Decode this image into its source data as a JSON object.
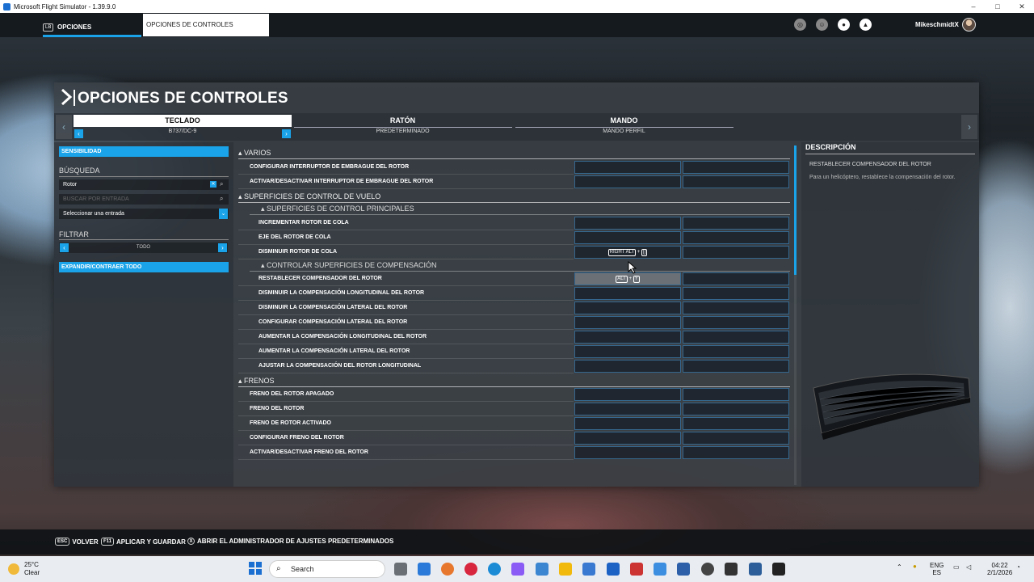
{
  "window": {
    "title": "Microsoft Flight Simulator - 1.39.9.0"
  },
  "topbar": {
    "lb": "LB",
    "tab_options": "OPCIONES",
    "tab_controls": "OPCIONES DE CONTROLES",
    "username": "MikeschmidtX"
  },
  "panel": {
    "title": "OPCIONES DE CONTROLES"
  },
  "devices": [
    {
      "name": "TECLADO",
      "profile": "B737/DC-9"
    },
    {
      "name": "RATÓN",
      "profile": "PREDETERMINADO"
    },
    {
      "name": "MANDO",
      "profile": "MANDO PERFIL"
    }
  ],
  "left": {
    "sensitivity": "SENSIBILIDAD",
    "search_header": "BÚSQUEDA",
    "search_value": "Rotor",
    "search_input_placeholder": "BUSCAR POR ENTRADA",
    "select_entry": "Seleccionar una entrada",
    "filter_header": "FILTRAR",
    "filter_value": "TODO",
    "expand": "EXPANDIR/CONTRAER TODO"
  },
  "groups": {
    "varios": "VARIOS",
    "flight": "SUPERFICIES DE CONTROL DE VUELO",
    "principal": "SUPERFICIES DE CONTROL PRINCIPALES",
    "trim": "CONTROLAR SUPERFICIES DE COMPENSACIÓN",
    "brakes": "FRENOS"
  },
  "rows": {
    "varios": [
      "CONFIGURAR INTERRUPTOR DE EMBRAGUE DEL ROTOR",
      "ACTIVAR/DESACTIVAR INTERRUPTOR DE EMBRAGUE DEL ROTOR"
    ],
    "principal": [
      "INCREMENTAR ROTOR DE COLA",
      "EJE DEL ROTOR DE COLA",
      "DISMINUIR ROTOR DE COLA"
    ],
    "trim": [
      "RESTABLECER COMPENSADOR DEL ROTOR",
      "DISMINUIR LA COMPENSACIÓN LONGITUDINAL DEL ROTOR",
      "DISMINUIR LA COMPENSACIÓN LATERAL DEL ROTOR",
      "CONFIGURAR COMPENSACIÓN LATERAL DEL ROTOR",
      "AUMENTAR LA COMPENSACIÓN LONGITUDINAL DEL ROTOR",
      "AUMENTAR LA COMPENSACIÓN LATERAL DEL ROTOR",
      "AJUSTAR LA COMPENSACIÓN DEL ROTOR LONGITUDINAL"
    ],
    "brakes": [
      "FRENO DEL ROTOR APAGADO",
      "FRENO DEL ROTOR",
      "FRENO DE ROTOR ACTIVADO",
      "CONFIGURAR FRENO DEL ROTOR",
      "ACTIVAR/DESACTIVAR FRENO DEL ROTOR"
    ]
  },
  "bindings": {
    "decrease_tail_key": "RIGHT ALT",
    "decrease_tail_plus": "+",
    "decrease_tail_extra": "[]",
    "reset_trim_key1": "ALT",
    "reset_trim_plus": "+",
    "reset_trim_key2": "Y"
  },
  "description": {
    "header": "DESCRIPCIÓN",
    "title": "RESTABLECER COMPENSADOR DEL ROTOR",
    "body": "Para un helicóptero, restablece la compensación del rotor."
  },
  "bottom": {
    "back_key": "ESC",
    "back": "VOLVER",
    "apply_key": "F11",
    "apply": "APLICAR Y GUARDAR",
    "presets_key": "X",
    "presets": "ABRIR EL ADMINISTRADOR DE AJUSTES PREDETERMINADOS"
  },
  "taskbar": {
    "temp": "25°C",
    "weather": "Clear",
    "search": "Search",
    "lang1": "ENG",
    "lang2": "ES",
    "time": "04:22",
    "date": "2/1/2026"
  },
  "colors": {
    "accent": "#1aa3e8",
    "panel": "#3a4046"
  }
}
